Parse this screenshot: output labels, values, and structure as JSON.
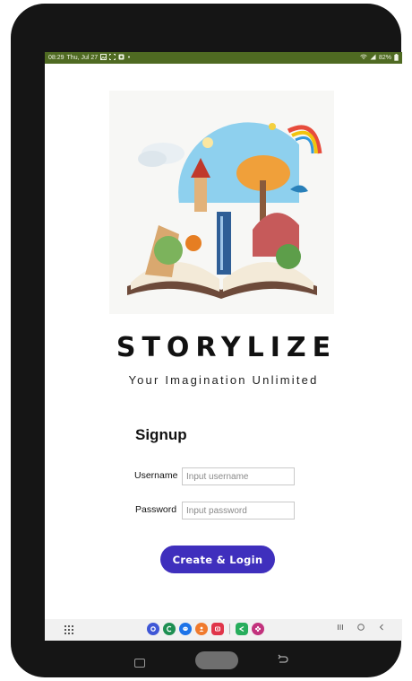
{
  "status_bar": {
    "time": "08:29",
    "date": "Thu, Jul 27",
    "battery": "82%",
    "background": "#4f6a22"
  },
  "app": {
    "brand": "STORYLIZE",
    "tagline": "Your Imagination Unlimited"
  },
  "signup": {
    "title": "Signup",
    "username_label": "Username",
    "username_placeholder": "Input username",
    "password_label": "Password",
    "password_placeholder": "Input password",
    "submit_label": "Create & Login",
    "accent": "#3f2fbd"
  },
  "taskbar": {
    "apps": [
      {
        "icon": "blue-app-icon",
        "color": "#3f57d6"
      },
      {
        "icon": "green-app-icon",
        "color": "#1e8f52"
      },
      {
        "icon": "messages-icon",
        "color": "#1c73e8"
      },
      {
        "icon": "orange-app-icon",
        "color": "#f07a2d"
      },
      {
        "icon": "red-app-icon",
        "color": "#e0354a"
      },
      {
        "icon": "share-app-icon",
        "color": "#27ad5c"
      },
      {
        "icon": "flower-app-icon",
        "color": "#c2327d"
      }
    ]
  }
}
